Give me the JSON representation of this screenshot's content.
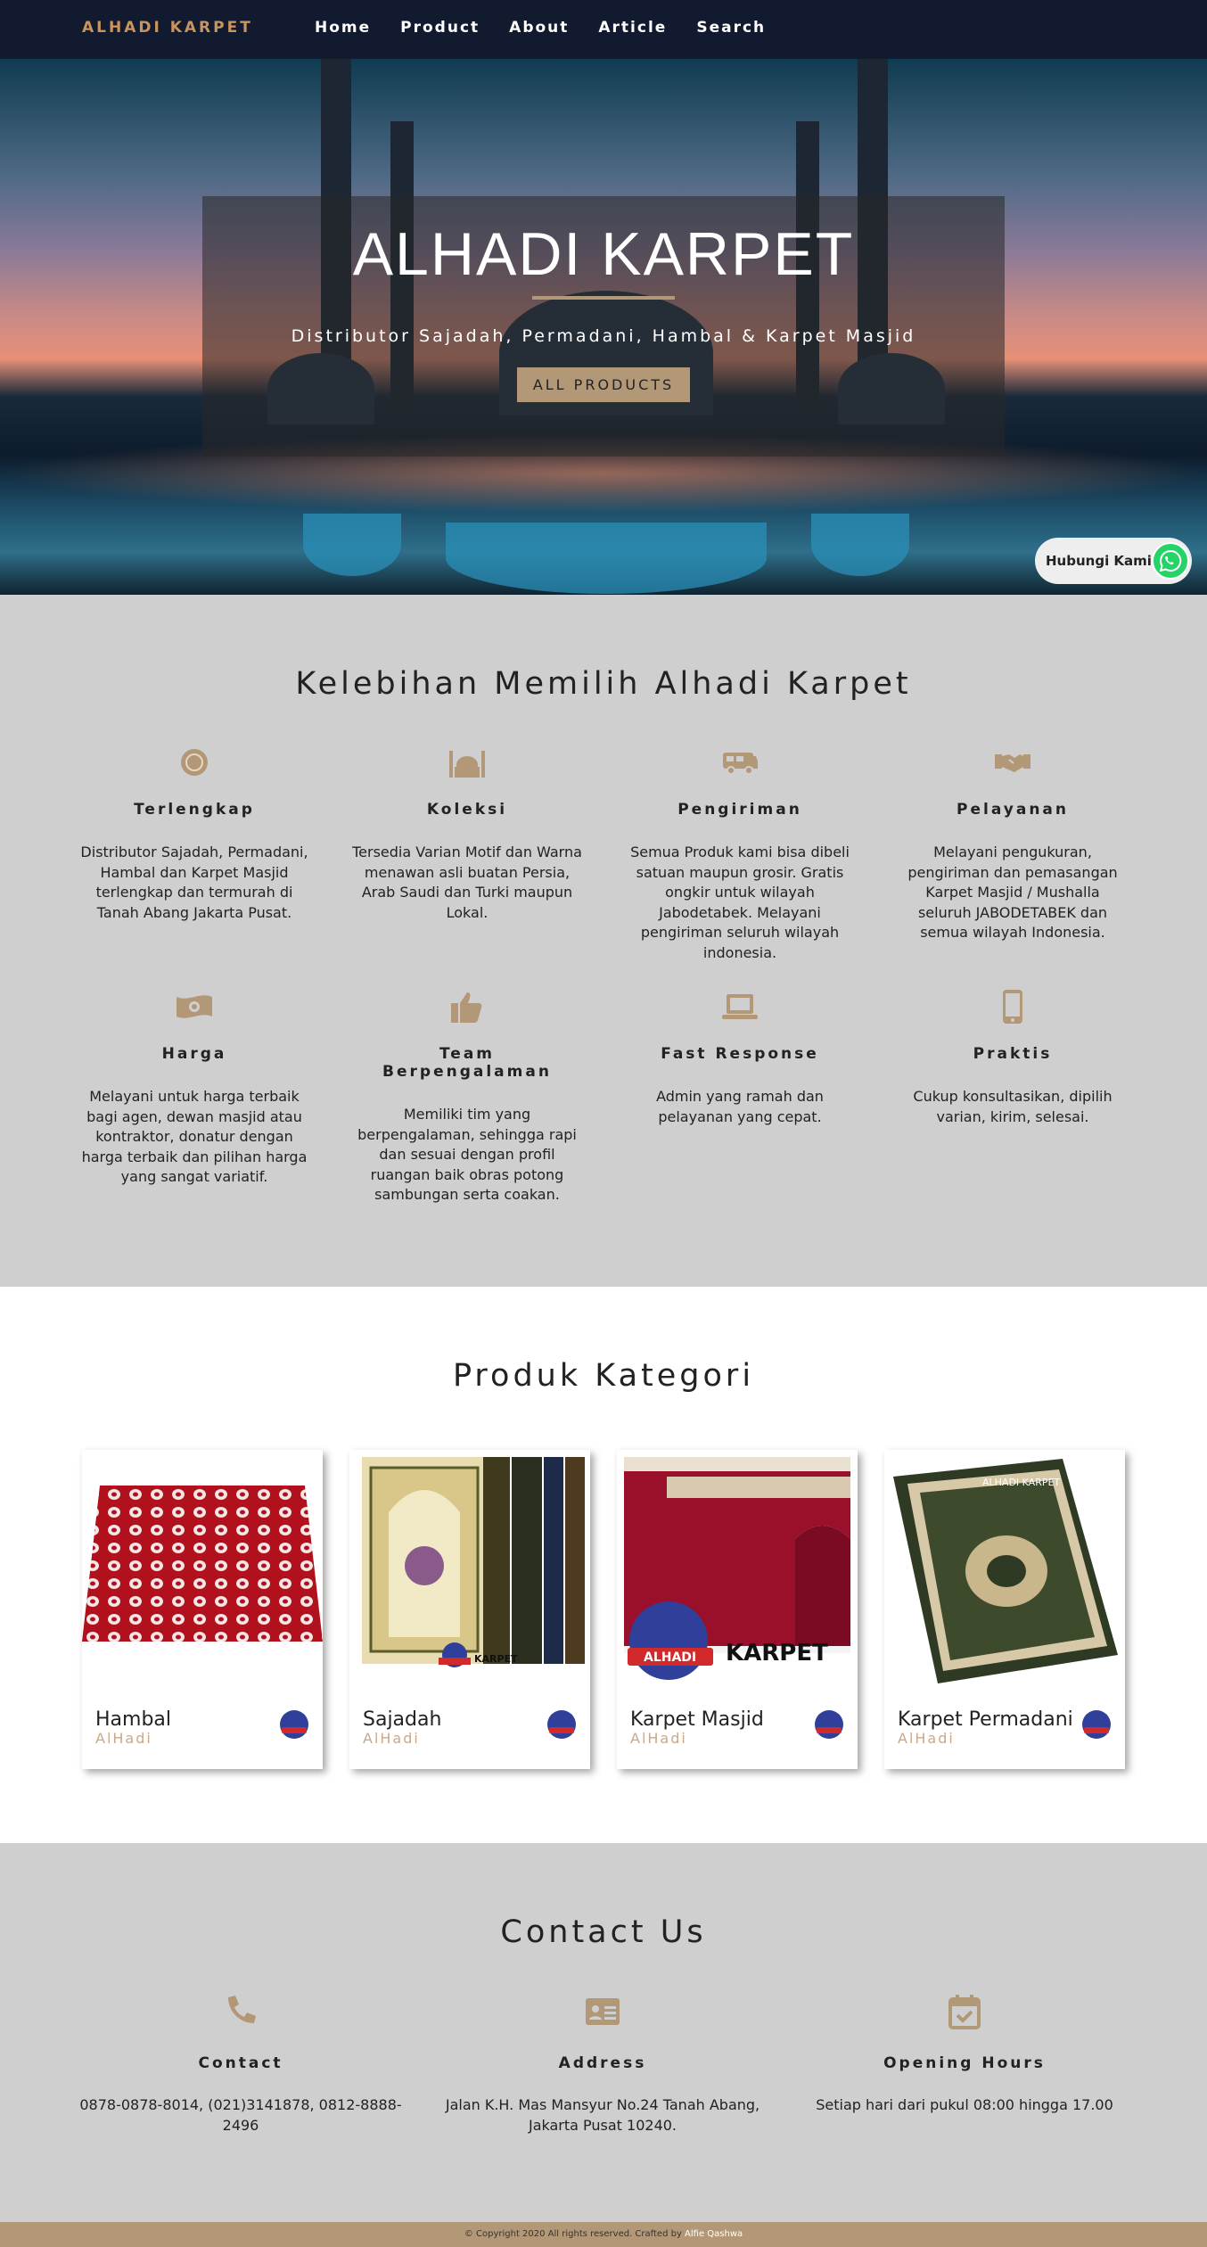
{
  "nav": {
    "brand": "ALHADI KARPET",
    "menu": [
      "Home",
      "Product",
      "About",
      "Article",
      "Search"
    ]
  },
  "hero": {
    "title": "ALHADI KARPET",
    "subtitle": "Distributor Sajadah, Permadani, Hambal & Karpet Masjid",
    "button": "ALL PRODUCTS",
    "whatsapp_label": "Hubungi Kami"
  },
  "advantages": {
    "title": "Kelebihan Memilih Alhadi Karpet",
    "items": [
      {
        "icon": "medal-icon",
        "title": "Terlengkap",
        "text": "Distributor Sajadah, Permadani, Hambal dan Karpet Masjid terlengkap dan termurah di Tanah Abang Jakarta Pusat."
      },
      {
        "icon": "mosque-icon",
        "title": "Koleksi",
        "text": "Tersedia Varian Motif dan Warna menawan asli buatan Persia, Arab Saudi dan Turki maupun Lokal."
      },
      {
        "icon": "van-icon",
        "title": "Pengiriman",
        "text": "Semua Produk kami bisa dibeli satuan maupun grosir. Gratis ongkir untuk wilayah Jabodetabek. Melayani pengiriman seluruh wilayah indonesia."
      },
      {
        "icon": "handshake-icon",
        "title": "Pelayanan",
        "text": "Melayani pengukuran, pengiriman dan pemasangan Karpet Masjid / Mushalla seluruh JABODETABEK dan semua wilayah Indonesia."
      },
      {
        "icon": "money-icon",
        "title": "Harga",
        "text": "Melayani untuk harga terbaik bagi agen, dewan masjid atau kontraktor, donatur dengan harga terbaik dan pilihan harga yang sangat variatif."
      },
      {
        "icon": "thumbs-up-icon",
        "title": "Team Berpengalaman",
        "text": "Memiliki tim yang berpengalaman, sehingga rapi dan sesuai dengan profil ruangan baik obras potong sambungan serta coakan."
      },
      {
        "icon": "laptop-icon",
        "title": "Fast Response",
        "text": "Admin yang ramah dan pelayanan yang cepat."
      },
      {
        "icon": "mobile-icon",
        "title": "Praktis",
        "text": "Cukup konsultasikan, dipilih varian, kirim, selesai."
      }
    ]
  },
  "products": {
    "title": "Produk Kategori",
    "items": [
      {
        "name": "Hambal",
        "brand": "AlHadi"
      },
      {
        "name": "Sajadah",
        "brand": "AlHadi"
      },
      {
        "name": "Karpet Masjid",
        "brand": "AlHadi"
      },
      {
        "name": "Karpet Permadani",
        "brand": "AlHadi"
      }
    ],
    "image_text": {
      "logo": "ALHADI",
      "karpet": "KARPET",
      "permadani_banner": "ALHADI KARPET"
    }
  },
  "contact": {
    "title": "Contact Us",
    "items": [
      {
        "icon": "phone-icon",
        "title": "Contact",
        "text": "0878-0878-8014, (021)3141878, 0812-8888-2496"
      },
      {
        "icon": "address-card-icon",
        "title": "Address",
        "text": "Jalan K.H. Mas Mansyur No.24 Tanah Abang, Jakarta Pusat 10240."
      },
      {
        "icon": "calendar-check-icon",
        "title": "Opening Hours",
        "text": "Setiap hari dari pukul 08:00 hingga 17.00"
      }
    ]
  },
  "footer": {
    "text": "© Copyright 2020 All rights reserved. Crafted by ",
    "credit": "Alfie Qashwa"
  },
  "colors": {
    "accent": "#b39877",
    "nav_bg": "#111a2e",
    "section_bg": "#cfcfcf"
  }
}
